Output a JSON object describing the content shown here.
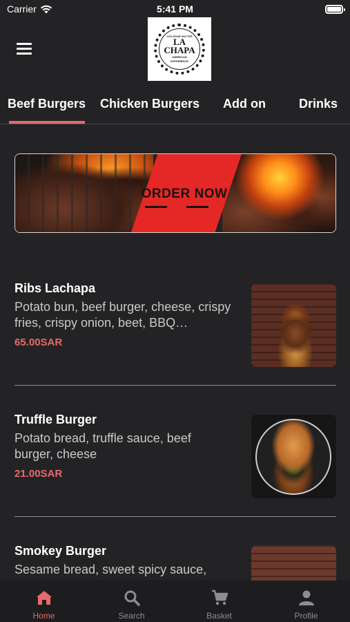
{
  "status_bar": {
    "carrier": "Carrier",
    "time": "5:41 PM"
  },
  "header": {
    "logo": {
      "top_text": "1933 BONE MATTER",
      "name_line1": "LA",
      "name_line2": "CHAPA",
      "sub_text_line1": "AMERICAN",
      "sub_text_line2": "EXPERIENCE"
    }
  },
  "tabs": [
    {
      "label": "Beef Burgers",
      "active": true
    },
    {
      "label": "Chicken Burgers",
      "active": false
    },
    {
      "label": "Add on",
      "active": false
    },
    {
      "label": "Drinks",
      "active": false
    }
  ],
  "banner": {
    "cta": "ORDER NOW"
  },
  "products": [
    {
      "name": "Ribs Lachapa",
      "description": "Potato bun, beef burger, cheese, crispy fries, crispy onion, beet, BBQ…",
      "price": "65.00SAR"
    },
    {
      "name": "Truffle Burger",
      "description": "Potato bread, truffle sauce, beef burger, cheese",
      "price": "21.00SAR"
    },
    {
      "name": "Smokey Burger",
      "description": "Sesame bread, sweet spicy sauce,"
    }
  ],
  "bottom_nav": [
    {
      "label": "Home",
      "icon": "home-icon",
      "active": true
    },
    {
      "label": "Search",
      "icon": "search-icon",
      "active": false
    },
    {
      "label": "Basket",
      "icon": "cart-icon",
      "active": false
    },
    {
      "label": "Profile",
      "icon": "profile-icon",
      "active": false
    }
  ],
  "colors": {
    "background": "#232325",
    "accent": "#e86a6a",
    "banner_red": "#e52826",
    "nav_background": "#1d1d1f",
    "inactive": "#8e8e90"
  }
}
